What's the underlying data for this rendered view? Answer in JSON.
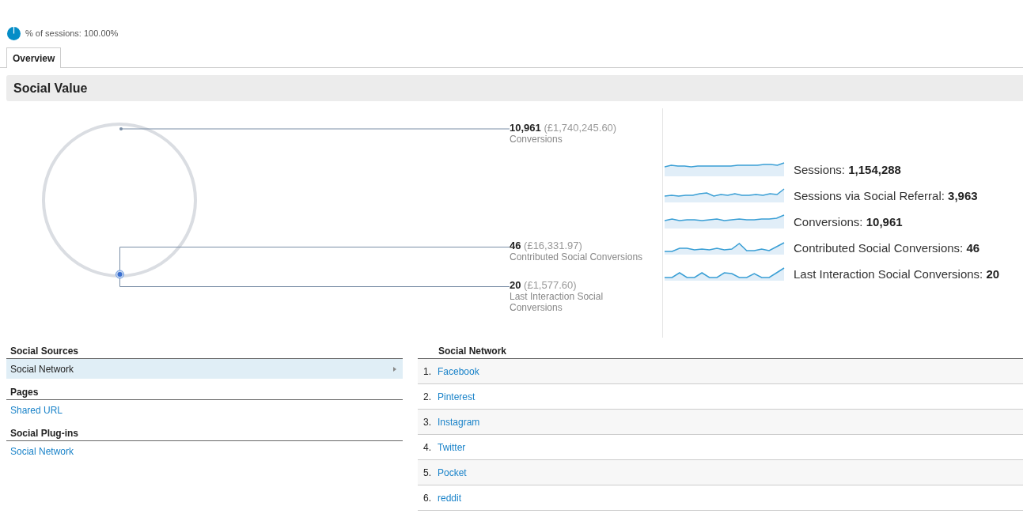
{
  "segment": {
    "label": "% of sessions: 100.00%"
  },
  "tabs": [
    {
      "label": "Overview",
      "selected": true
    }
  ],
  "section_title": "Social Value",
  "callouts": [
    {
      "value": "10,961",
      "amount": "(£1,740,245.60)",
      "label": "Conversions"
    },
    {
      "value": "46",
      "amount": "(£16,331.97)",
      "label": "Contributed Social Conversions"
    },
    {
      "value": "20",
      "amount": "(£1,577.60)",
      "label": "Last Interaction Social Conversions"
    }
  ],
  "metrics": [
    {
      "label": "Sessions:",
      "value": "1,154,288"
    },
    {
      "label": "Sessions via Social Referral:",
      "value": "3,963"
    },
    {
      "label": "Conversions:",
      "value": "10,961"
    },
    {
      "label": "Contributed Social Conversions:",
      "value": "46"
    },
    {
      "label": "Last Interaction Social Conversions:",
      "value": "20"
    }
  ],
  "sources": [
    {
      "heading": "Social Sources",
      "items": [
        {
          "label": "Social Network",
          "selected": true
        }
      ]
    },
    {
      "heading": "Pages",
      "items": [
        {
          "label": "Shared URL",
          "selected": false
        }
      ]
    },
    {
      "heading": "Social Plug-ins",
      "items": [
        {
          "label": "Social Network",
          "selected": false
        }
      ]
    }
  ],
  "network_table": {
    "column": "Social Network",
    "rows": [
      {
        "rank": "1.",
        "name": "Facebook"
      },
      {
        "rank": "2.",
        "name": "Pinterest"
      },
      {
        "rank": "3.",
        "name": "Instagram"
      },
      {
        "rank": "4.",
        "name": "Twitter"
      },
      {
        "rank": "5.",
        "name": "Pocket"
      },
      {
        "rank": "6.",
        "name": "reddit"
      }
    ]
  }
}
